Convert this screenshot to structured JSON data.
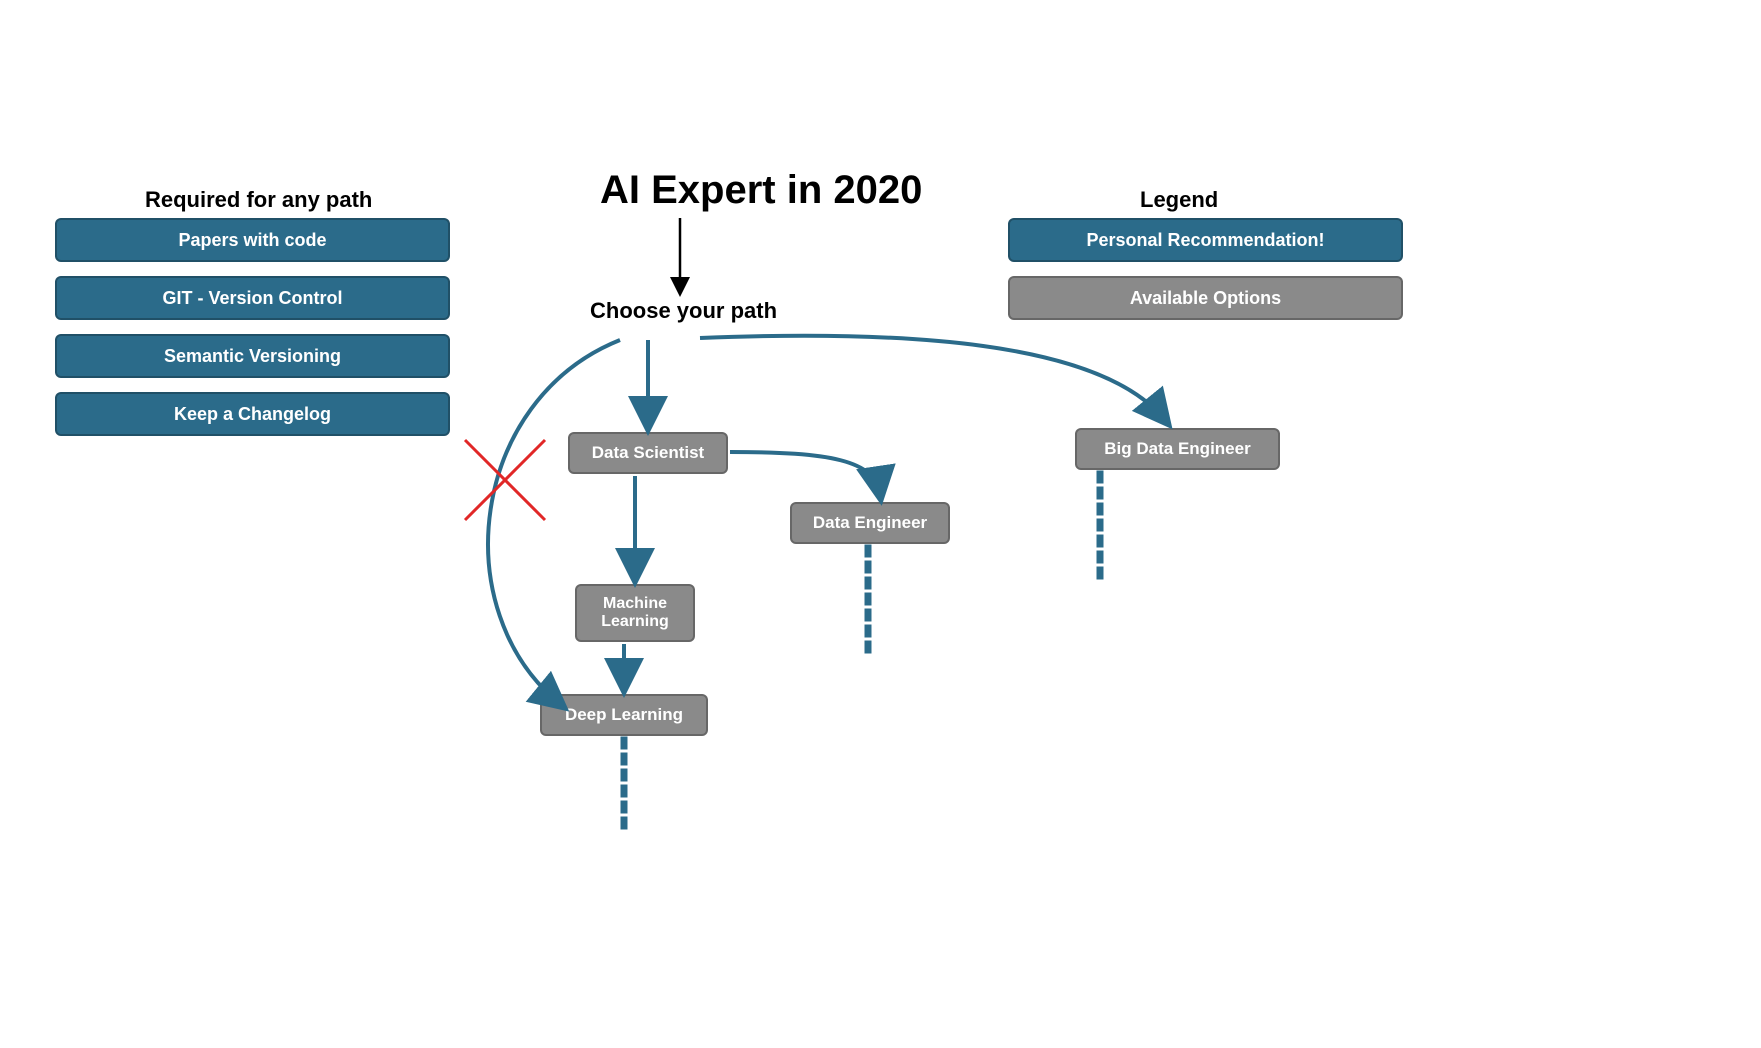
{
  "title": "AI Expert in 2020",
  "choose_label": "Choose your path",
  "required": {
    "heading": "Required for any path",
    "items": [
      "Papers with code",
      "GIT - Version Control",
      "Semantic Versioning",
      "Keep a Changelog"
    ]
  },
  "legend": {
    "heading": "Legend",
    "recommendation": "Personal Recommendation!",
    "available": "Available Options"
  },
  "nodes": {
    "data_scientist": "Data Scientist",
    "machine_learning": "Machine Learning",
    "deep_learning": "Deep Learning",
    "data_engineer": "Data Engineer",
    "big_data_engineer": "Big Data Engineer"
  },
  "colors": {
    "blue": "#2b6b8a",
    "gray": "#8a8a8a",
    "arrow": "#2b6b8a",
    "cross": "#e12727"
  }
}
